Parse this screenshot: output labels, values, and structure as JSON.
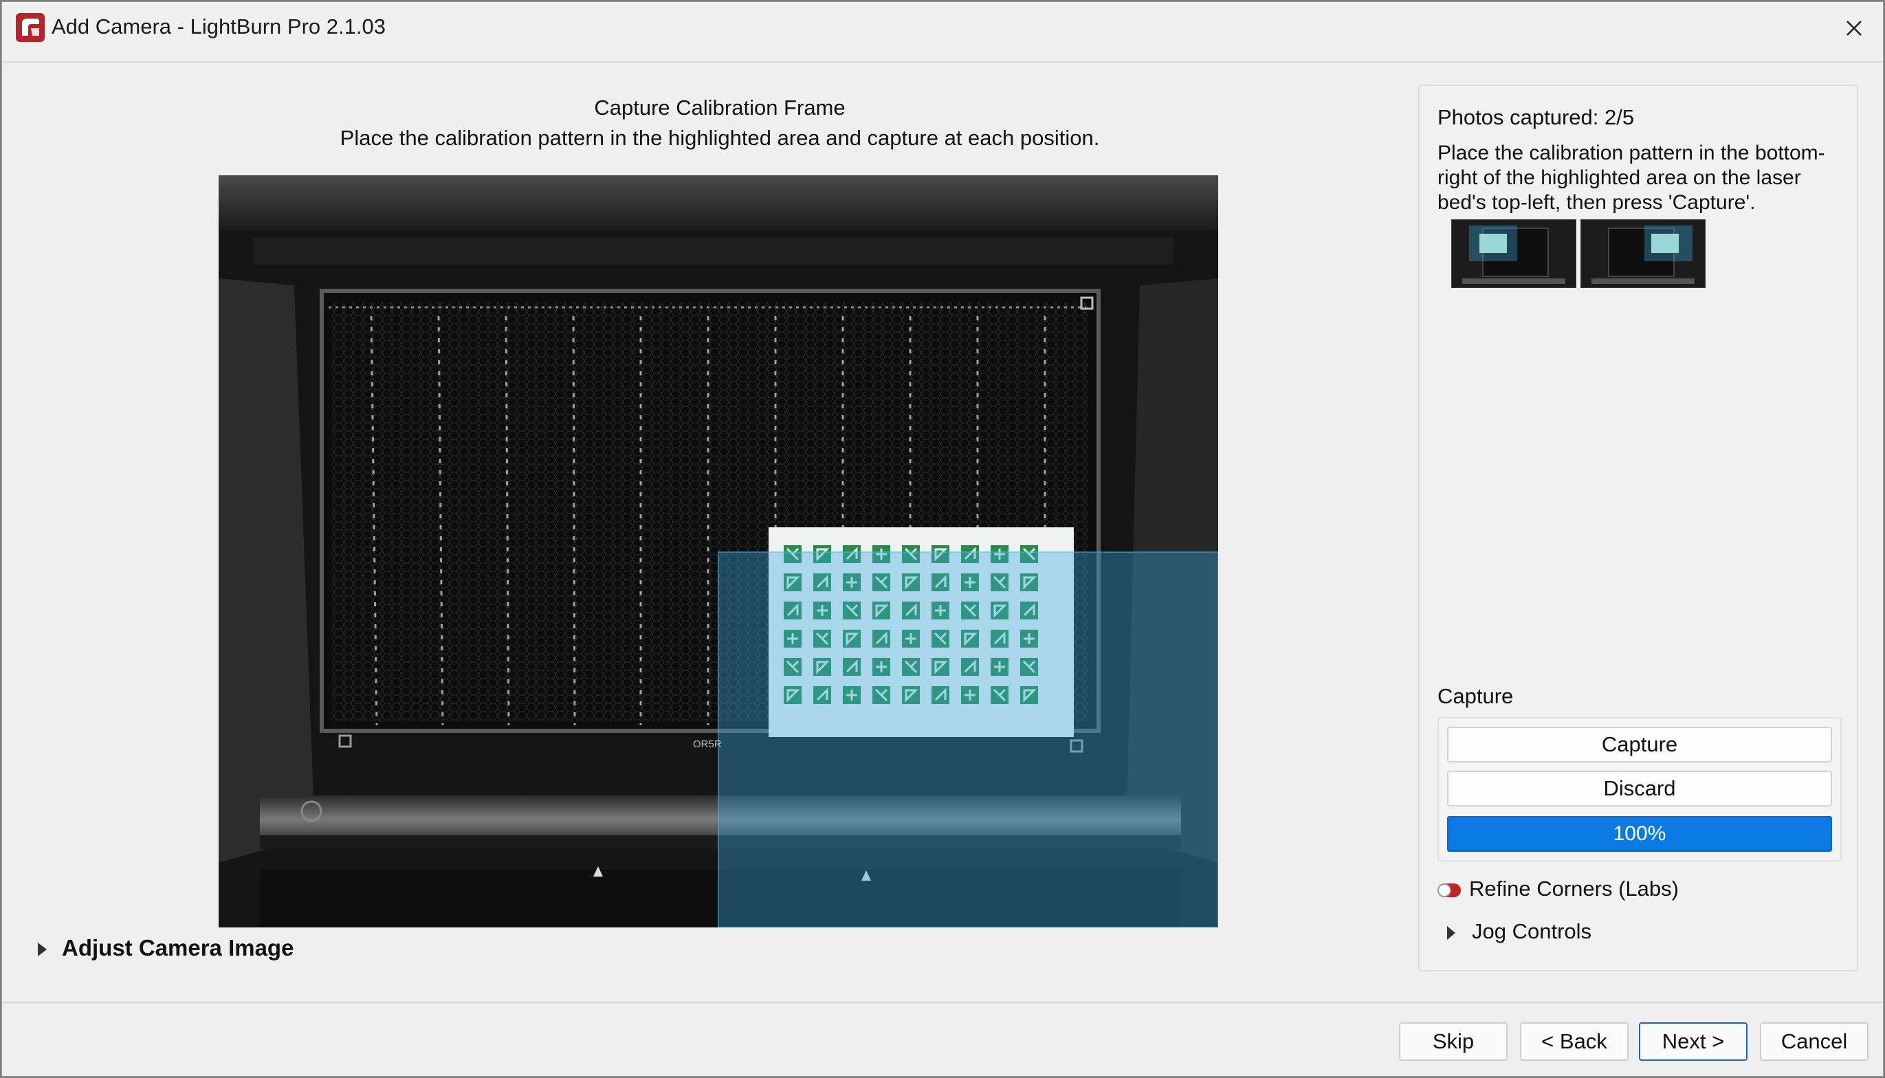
{
  "window": {
    "title": "Add Camera - LightBurn Pro 2.1.03"
  },
  "icons": {
    "app": "lightburn-logo-icon",
    "close": "close-icon",
    "expand": "triangle-right-icon"
  },
  "header": {
    "title": "Capture Calibration Frame",
    "subtitle": "Place the calibration pattern in the highlighted area and capture at each position."
  },
  "camera_view": {
    "bed_label": "OR5R",
    "highlight_color": "#3aa8e0",
    "pattern_color": "#2a8a4a"
  },
  "adjust_camera": {
    "label": "Adjust Camera Image"
  },
  "panel": {
    "photos_label": "Photos captured: 2/5",
    "photos_captured": 2,
    "photos_total": 5,
    "instructions": "Place the calibration pattern in the bottom-right of the highlighted area on the laser bed's top-left, then press 'Capture'.",
    "thumbnails": [
      "capture-1",
      "capture-2"
    ],
    "capture_section": {
      "label": "Capture",
      "capture_button": "Capture",
      "discard_button": "Discard",
      "progress_text": "100%",
      "progress_value": 1.0
    },
    "refine_corners": {
      "label": "Refine Corners (Labs)",
      "enabled": false,
      "toggle_color": "#c02326"
    },
    "jog_controls": {
      "label": "Jog Controls"
    }
  },
  "footer": {
    "skip": "Skip",
    "back": "< Back",
    "next": "Next >",
    "cancel": "Cancel"
  },
  "colors": {
    "accent": "#1a73e8",
    "window_bg": "#efefef"
  }
}
